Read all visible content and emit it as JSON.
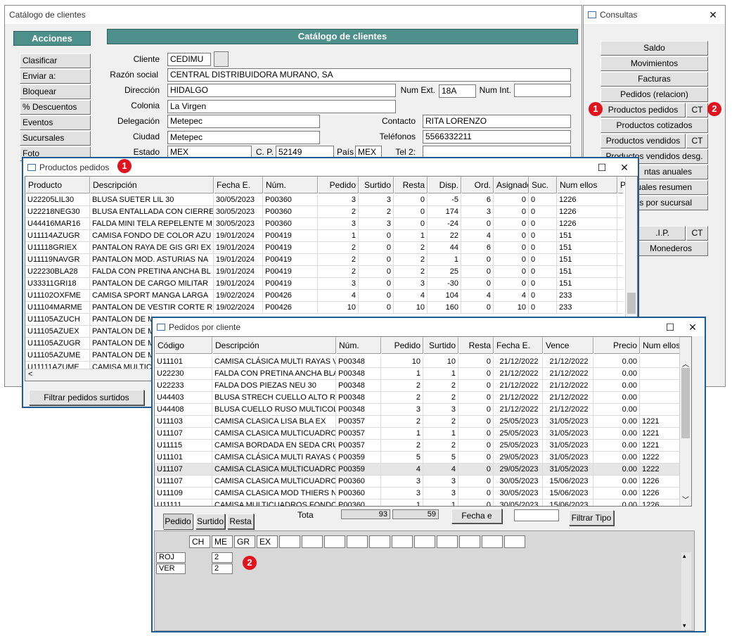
{
  "main_window": {
    "title": "Catálogo de clientes",
    "acciones": "Acciones",
    "header": "Catálogo de clientes",
    "menu": [
      "Clasificar",
      "Enviar a:",
      "Bloquear",
      "% Descuentos",
      "Eventos",
      "Sucursales",
      "Foto"
    ],
    "labels": {
      "cliente": "Cliente",
      "razon": "Razón social",
      "direccion": "Dirección",
      "numext": "Num Ext.",
      "numint": "Num Int.",
      "colonia": "Colonia",
      "delegacion": "Delegación",
      "contacto": "Contacto",
      "ciudad": "Ciudad",
      "telefonos": "Teléfonos",
      "estado": "Estado",
      "cp": "C. P.",
      "pais": "País",
      "tel2": "Tel 2:"
    },
    "values": {
      "cliente": "CEDIMU",
      "razon": "CENTRAL DISTRIBUIDORA MURANO, SA",
      "direccion": "HIDALGO",
      "numext": "18A",
      "numint": "",
      "colonia": "La Virgen",
      "delegacion": "Metepec",
      "contacto": "RITA LORENZO",
      "ciudad": "Metepec",
      "telefonos": "5566332211",
      "estado": "MEX",
      "cp": "52149",
      "pais": "MEX",
      "tel2": ""
    }
  },
  "consultas": {
    "title": "Consultas",
    "items": [
      "Saldo",
      "Movimientos",
      "Facturas",
      "Pedidos (relacion)",
      "Productos pedidos",
      "Productos cotizados",
      "Productos vendidos",
      "Productos vendidos desg.",
      "Ventas anuales",
      "Ventas anuales resumen",
      "Ventas por sucursal"
    ],
    "visible_items": [
      "Saldo",
      "Movimientos",
      "Facturas",
      "Pedidos (relacion)",
      "Productos pedidos",
      "Productos cotizados",
      "Productos vendidos",
      "Productos vendidos desg.",
      "ntas anuales",
      "anuales resumen",
      "as por sucursal",
      ".I.P.",
      "Monederos"
    ],
    "ct": "CT"
  },
  "productos": {
    "title": "Productos pedidos",
    "columns": [
      "Producto",
      "Descripción",
      "Fecha E.",
      "Núm.",
      "Pedido",
      "Surtido",
      "Resta",
      "Disp.",
      "Ord.",
      "Asignado",
      "Suc.",
      "Num ellos",
      "Pzas"
    ],
    "rows": [
      [
        "U22205LIL30",
        "BLUSA SUETER LIL 30",
        "30/05/2023",
        "P00360",
        "3",
        "3",
        "0",
        "-5",
        "6",
        "0",
        "0",
        "1226"
      ],
      [
        "U22218NEG30",
        "BLUSA ENTALLADA CON CIERRE",
        "30/05/2023",
        "P00360",
        "2",
        "2",
        "0",
        "174",
        "3",
        "0",
        "0",
        "1226"
      ],
      [
        "U44416MAR16",
        "FALDA MINI TELA REPELENTE M",
        "30/05/2023",
        "P00360",
        "3",
        "3",
        "0",
        "-24",
        "0",
        "0",
        "0",
        "1226"
      ],
      [
        "U11114AZUGR",
        "CAMISA FONDO DE COLOR AZU",
        "19/01/2024",
        "P00419",
        "1",
        "0",
        "1",
        "22",
        "4",
        "0",
        "0",
        "151"
      ],
      [
        "U11118GRIEX",
        "PANTALON RAYA DE GIS GRI EX",
        "19/01/2024",
        "P00419",
        "2",
        "0",
        "2",
        "44",
        "6",
        "0",
        "0",
        "151"
      ],
      [
        "U11119NAVGR",
        "PANTALON MOD. ASTURIAS NA",
        "19/01/2024",
        "P00419",
        "2",
        "0",
        "2",
        "1",
        "0",
        "0",
        "0",
        "151"
      ],
      [
        "U22230BLA28",
        "FALDA CON PRETINA ANCHA BL",
        "19/01/2024",
        "P00419",
        "2",
        "0",
        "2",
        "25",
        "0",
        "0",
        "0",
        "151"
      ],
      [
        "U33311GRI18",
        "PANTALON DE CARGO MILITAR",
        "19/01/2024",
        "P00419",
        "3",
        "0",
        "3",
        "-30",
        "0",
        "0",
        "0",
        "151"
      ],
      [
        "U11102OXFME",
        "CAMISA SPORT MANGA LARGA",
        "19/02/2024",
        "P00426",
        "4",
        "0",
        "4",
        "104",
        "4",
        "4",
        "0",
        "233"
      ],
      [
        "U11104MARME",
        "PANTALON DE VESTIR CORTE R",
        "19/02/2024",
        "P00426",
        "10",
        "0",
        "10",
        "160",
        "0",
        "10",
        "0",
        "233"
      ],
      [
        "U11105AZUCH",
        "PANTALON DE M",
        "",
        "",
        "",
        "",
        "",
        "",
        "",
        "",
        "",
        ""
      ],
      [
        "U11105AZUEX",
        "PANTALON DE M",
        "",
        "",
        "",
        "",
        "",
        "",
        "",
        "",
        "",
        ""
      ],
      [
        "U11105AZUGR",
        "PANTALON DE M",
        "",
        "",
        "",
        "",
        "",
        "",
        "",
        "",
        "",
        ""
      ],
      [
        "U11105AZUME",
        "PANTALON DE M",
        "",
        "",
        "",
        "",
        "",
        "",
        "",
        "",
        "",
        ""
      ],
      [
        "U11111AZUME",
        "CAMISA MULTIC",
        "",
        "",
        "",
        "",
        "",
        "",
        "",
        "",
        "",
        ""
      ]
    ],
    "filter_button": "Filtrar pedidos surtidos"
  },
  "pedidos": {
    "title": "Pedidos por cliente",
    "columns": [
      "Código",
      "Descripción",
      "Núm.",
      "Pedido",
      "Surtido",
      "Resta",
      "Fecha E.",
      "Vence",
      "Precio",
      "Num ellos"
    ],
    "rows": [
      [
        "U11101",
        "CAMISA CLÁSICA MULTI RAYAS V",
        "P00348",
        "10",
        "10",
        "0",
        "21/12/2022",
        "21/12/2022",
        "0.00",
        ""
      ],
      [
        "U22230",
        "FALDA CON PRETINA ANCHA BLA",
        "P00348",
        "1",
        "1",
        "0",
        "21/12/2022",
        "21/12/2022",
        "0.00",
        ""
      ],
      [
        "U22233",
        "FALDA DOS PIEZAS NEU 30",
        "P00348",
        "2",
        "2",
        "0",
        "21/12/2022",
        "21/12/2022",
        "0.00",
        ""
      ],
      [
        "U44403",
        "BLUSA STRECH CUELLO ALTO RO",
        "P00348",
        "2",
        "2",
        "0",
        "21/12/2022",
        "21/12/2022",
        "0.00",
        ""
      ],
      [
        "U44408",
        "BLUSA CUELLO RUSO MULTICOLO",
        "P00348",
        "3",
        "3",
        "0",
        "21/12/2022",
        "21/12/2022",
        "0.00",
        ""
      ],
      [
        "U11103",
        "CAMISA CLASICA LISA BLA EX",
        "P00357",
        "2",
        "2",
        "0",
        "25/05/2023",
        "31/05/2023",
        "0.00",
        "1221"
      ],
      [
        "U11107",
        "CAMISA CLASICA MULTICUADRO",
        "P00357",
        "1",
        "1",
        "0",
        "25/05/2023",
        "31/05/2023",
        "0.00",
        "1221"
      ],
      [
        "U11115",
        "CAMISA BORDADA EN SEDA CRU",
        "P00357",
        "2",
        "2",
        "0",
        "25/05/2023",
        "31/05/2023",
        "0.00",
        "1221"
      ],
      [
        "U11101",
        "CAMISA CLÁSICA MULTI RAYAS C",
        "P00359",
        "5",
        "5",
        "0",
        "29/05/2023",
        "31/05/2023",
        "0.00",
        "1222"
      ],
      [
        "U11107",
        "CAMISA CLASICA MULTICUADRO",
        "P00359",
        "4",
        "4",
        "0",
        "29/05/2023",
        "31/05/2023",
        "0.00",
        "1222"
      ],
      [
        "U11107",
        "CAMISA CLASICA MULTICUADRO",
        "P00360",
        "3",
        "3",
        "0",
        "30/05/2023",
        "15/06/2023",
        "0.00",
        "1226"
      ],
      [
        "U11109",
        "CAMISA CLASICA MOD THIERS N",
        "P00360",
        "3",
        "3",
        "0",
        "30/05/2023",
        "15/06/2023",
        "0.00",
        "1226"
      ],
      [
        "U11111",
        "CAMISA MULTICUADROS FONDO",
        "P00360",
        "1",
        "1",
        "0",
        "30/05/2023",
        "15/06/2023",
        "0.00",
        "1226"
      ]
    ],
    "buttons": {
      "pedido": "Pedido",
      "surtido": "Surtido",
      "resta": "Resta",
      "fecha": "Fecha e",
      "filtrar": "Filtrar Tipo"
    },
    "total_label": "Tota",
    "total_pedido": "93",
    "total_surtido": "59",
    "size_headers": [
      "CH",
      "ME",
      "GR",
      "EX",
      "",
      "",
      "",
      "",
      "",
      "",
      "",
      "",
      "",
      "",
      ""
    ],
    "color_rows": [
      {
        "color": "ROJ",
        "qty": "2"
      },
      {
        "color": "VER",
        "qty": "2"
      }
    ]
  },
  "badges": {
    "one": "1",
    "two": "2"
  }
}
